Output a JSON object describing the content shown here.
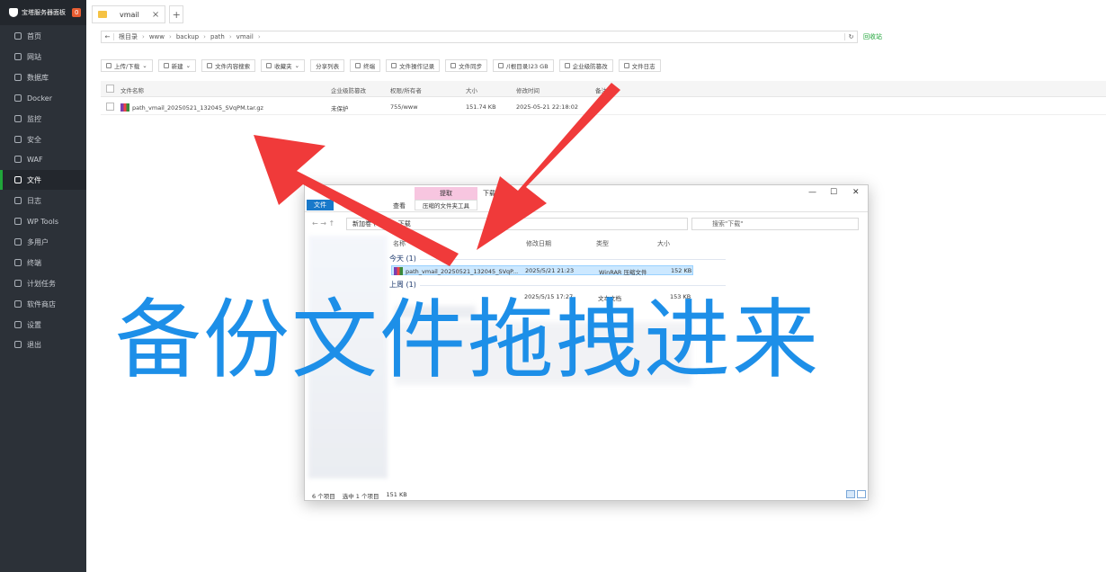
{
  "sidebar": {
    "brand": "宝塔服务器面板",
    "badge": "0",
    "items": [
      {
        "label": "首页",
        "icon": "home-icon"
      },
      {
        "label": "网站",
        "icon": "globe-icon"
      },
      {
        "label": "数据库",
        "icon": "database-icon"
      },
      {
        "label": "Docker",
        "icon": "docker-icon"
      },
      {
        "label": "监控",
        "icon": "monitor-icon"
      },
      {
        "label": "安全",
        "icon": "shield-icon"
      },
      {
        "label": "WAF",
        "icon": "waf-icon"
      },
      {
        "label": "文件",
        "icon": "folder-icon",
        "active": true
      },
      {
        "label": "日志",
        "icon": "log-icon"
      },
      {
        "label": "WP Tools",
        "icon": "wordpress-icon"
      },
      {
        "label": "多用户",
        "icon": "users-icon"
      },
      {
        "label": "终端",
        "icon": "terminal-icon"
      },
      {
        "label": "计划任务",
        "icon": "clock-icon"
      },
      {
        "label": "软件商店",
        "icon": "store-icon"
      },
      {
        "label": "设置",
        "icon": "gear-icon"
      },
      {
        "label": "退出",
        "icon": "logout-icon"
      }
    ]
  },
  "tabs": [
    {
      "label": "vmail"
    }
  ],
  "path": {
    "crumbs": [
      "根目录",
      "www",
      "backup",
      "path",
      "vmail"
    ],
    "recycle": "回收站"
  },
  "toolbar": {
    "upload": "上传/下载",
    "new": "新建",
    "search_content": "文件内容搜索",
    "favorites": "收藏夹",
    "share_list": "分享列表",
    "terminal": "终端",
    "op_log": "文件操作记录",
    "file_sync": "文件同步",
    "disk": "/(根目录)23 GB",
    "enterprise": "企业级防篡改",
    "file_log": "文件日志"
  },
  "table": {
    "headers": {
      "name": "文件名称",
      "protect": "企业级防篡改",
      "perm": "权限/所有者",
      "size": "大小",
      "mtime": "修改时间",
      "note": "备注"
    },
    "rows": [
      {
        "name": "path_vmail_20250521_132045_SVqPM.tar.gz",
        "protect": "未保护",
        "perm": "755/www",
        "size": "151.74 KB",
        "mtime": "2025-05-21 22:18:02"
      }
    ]
  },
  "explorer": {
    "tab_file": "文件",
    "tab_view": "查看",
    "extract_head": "提取",
    "extract_tab": "压缩的文件夹工具",
    "title": "下载",
    "address": [
      "新加卷 (C:)",
      "下载"
    ],
    "search_placeholder": "搜索\"下载\"",
    "columns": {
      "name": "名称",
      "date": "修改日期",
      "type": "类型",
      "size": "大小"
    },
    "groups": {
      "today": "今天 (1)",
      "last_week": "上周 (1)"
    },
    "rows": [
      {
        "name": "path_vmail_20250521_132045_SVqP...",
        "date": "2025/5/21 21:23",
        "type": "WinRAR 压缩文件",
        "size": "152 KB"
      },
      {
        "name": "",
        "date": "2025/5/15 17:27",
        "type": "文本文档",
        "size": "153 KB"
      }
    ],
    "status": {
      "count": "6 个项目",
      "selected": "选中 1 个项目",
      "selected_size": "151 KB"
    }
  },
  "caption": "备份文件拖拽进来",
  "colors": {
    "accent": "#20a53a",
    "caption": "#1d8fe8",
    "arrow": "#f03a3a",
    "sidebar": "#2c3138"
  }
}
